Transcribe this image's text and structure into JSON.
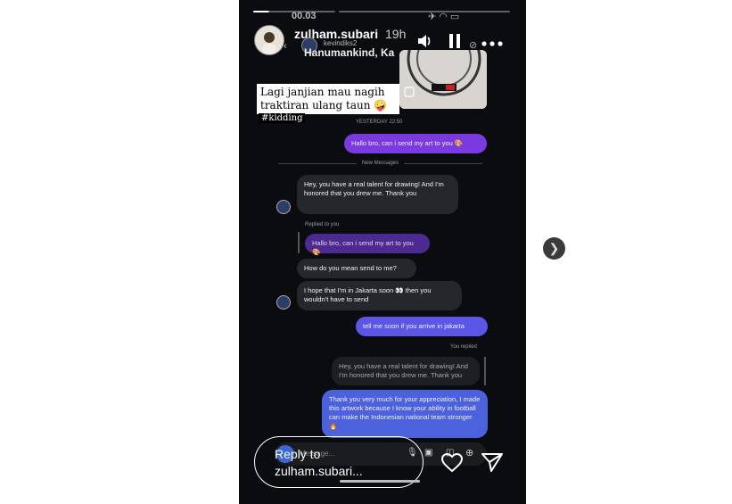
{
  "story": {
    "username": "zulham.subari",
    "age": "19h",
    "status_time": "00.03"
  },
  "dm_screen": {
    "contact_username": "kevindiks2",
    "contact_name": "Hanumankind, Ka",
    "sticker_text": "Lagi janjian mau nagih traktiran ulang taun 🤪",
    "hashtag": "#kidding",
    "timestamp_1": "YESTERDAY 22:50",
    "new_messages_label": "New Messages",
    "messages": [
      {
        "from": "me",
        "text": "Hallo bro, can i send my art to you 🎨"
      },
      {
        "from": "them",
        "text": "Hey, you have a real talent for drawing! And I'm honored that you drew me. Thank you"
      },
      {
        "label": "Replied to you"
      },
      {
        "from": "quote",
        "text": "Hallo bro, can i send my art to you 🎨"
      },
      {
        "from": "them",
        "text": "How do you mean send to me?"
      },
      {
        "from": "them",
        "text": "I hope that I'm in Jakarta soon 👀 then you wouldn't have to send"
      },
      {
        "from": "me",
        "text": "tell me soon if you arrive in jakarta"
      },
      {
        "label": "You replied"
      },
      {
        "from": "quote",
        "text": "Hey, you have a real talent for drawing! And I'm honored that you drew me. Thank you"
      },
      {
        "from": "me",
        "text": "Thank you very much for your appreciation, I made this artwork because I know your ability in football can make the Indonesian national team stronger 🔥"
      }
    ],
    "composer_placeholder": "Message..."
  },
  "reply": {
    "placeholder": "Reply to zulham.subari..."
  },
  "icons": {
    "volume": "speaker-icon",
    "pause": "pause-icon",
    "more": "more-icon",
    "heart": "heart-icon",
    "send": "send-icon",
    "next": "chevron-right-icon"
  }
}
